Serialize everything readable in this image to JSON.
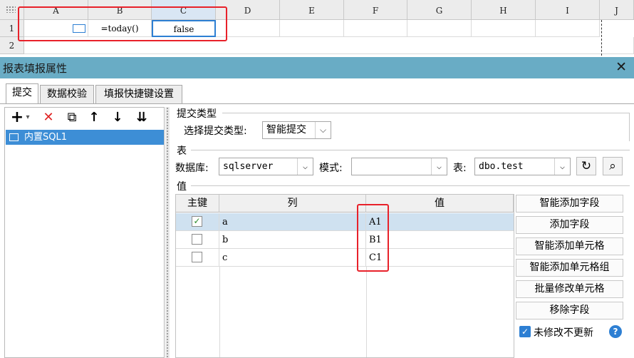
{
  "spreadsheet": {
    "columns": [
      "A",
      "B",
      "C",
      "D",
      "E",
      "F",
      "G",
      "H",
      "I",
      "J"
    ],
    "rows": [
      "1",
      "2"
    ],
    "cells": {
      "B1": "=today()",
      "C1": "false"
    }
  },
  "dialog": {
    "title": "报表填报属性",
    "close_glyph": "✕",
    "tabs": [
      "提交",
      "数据校验",
      "填报快捷键设置"
    ]
  },
  "left_panel": {
    "toolbar_glyphs": {
      "add": "+",
      "add_caret": "▾",
      "delete": "✕",
      "copy": "⧉",
      "move_up": "↑",
      "move_down": "↓",
      "move_bottom": "⇊"
    },
    "items": [
      {
        "label": "内置SQL1"
      }
    ]
  },
  "submit": {
    "section_title": "提交类型",
    "type_label": "选择提交类型:",
    "type_value": "智能提交"
  },
  "table_section": {
    "title": "表",
    "db_label": "数据库:",
    "db_value": "sqlserver",
    "mode_label": "模式:",
    "mode_value": "",
    "table_label": "表:",
    "table_value": "dbo.test",
    "refresh_glyph": "↻",
    "preview_glyph": "⌕"
  },
  "value_section": {
    "title": "值",
    "headers": [
      "主键",
      "列",
      "值"
    ],
    "rows": [
      {
        "key": true,
        "column": "a",
        "value": "A1"
      },
      {
        "key": false,
        "column": "b",
        "value": "B1"
      },
      {
        "key": false,
        "column": "c",
        "value": "C1"
      }
    ]
  },
  "right_buttons": [
    "智能添加字段",
    "添加字段",
    "智能添加单元格",
    "智能添加单元格组",
    "批量修改单元格",
    "移除字段"
  ],
  "options": {
    "no_update_label": "未修改不更新",
    "no_update_checked": true,
    "check_glyph": "✓",
    "help_glyph": "?"
  },
  "dropdown_glyph": "⌵",
  "colors": {
    "titlebar": "#69acc5",
    "selection": "#3d8ed6",
    "highlight_box": "#e8212a",
    "checkbox": "#2d7fd3"
  }
}
